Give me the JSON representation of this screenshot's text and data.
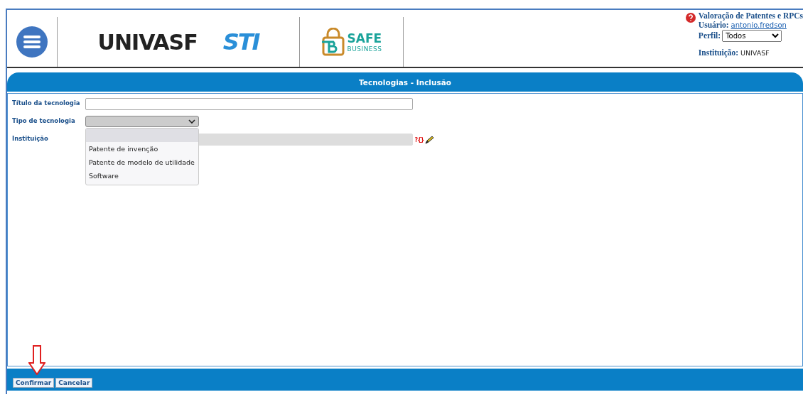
{
  "header": {
    "logos": [
      {
        "kind": "univasf",
        "text": "UNIVASF"
      },
      {
        "kind": "sti",
        "text": "STI"
      },
      {
        "kind": "safe",
        "text": "SAFE",
        "subtext": "BUSINESS"
      }
    ],
    "app_title": "Valoração de Patentes e RPCs",
    "user_label": "Usuário:",
    "user": "antonio.fredson",
    "profile_label": "Perfil:",
    "profile": "Todos",
    "institution_label": "Instituição:",
    "institution": "UNIVASF"
  },
  "panel_title": "Tecnologias - Inclusão",
  "fields": [
    {
      "label": "Título da tecnologia",
      "kind": "text"
    },
    {
      "label": "Tipo de tecnologia",
      "kind": "select",
      "expanded": true,
      "blank_selected": true,
      "options": [
        {
          "label": "Patente de invenção",
          "selected": false
        },
        {
          "label": "Patente de modelo de utilidade",
          "selected": false
        },
        {
          "label": "Software",
          "selected": false
        }
      ]
    },
    {
      "label": "Instituição",
      "kind": "lookup",
      "disabled": true,
      "lookup_symbol": "?{}"
    }
  ],
  "buttons": [
    {
      "label": "Confirmar"
    },
    {
      "label": "Cancelar"
    }
  ]
}
